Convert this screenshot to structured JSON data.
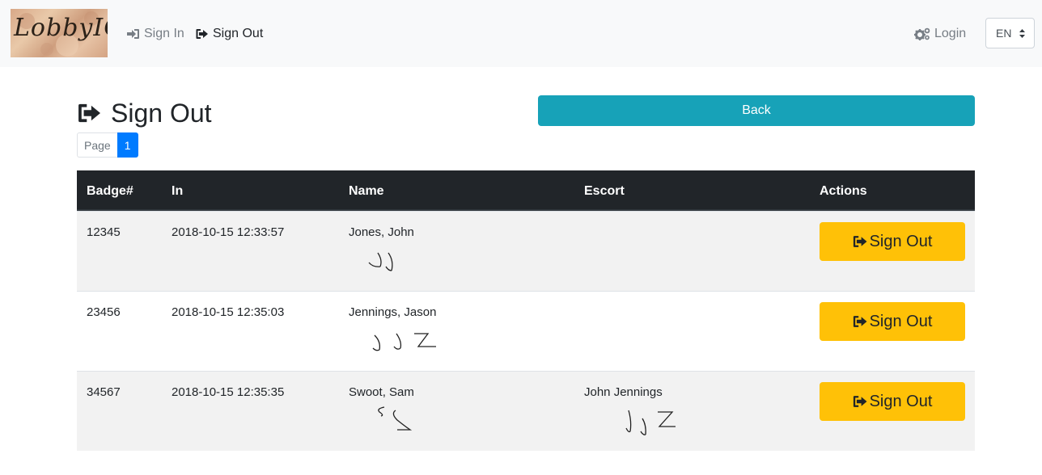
{
  "navbar": {
    "brand_text": "LobbyIO",
    "links": [
      {
        "label": "Sign In",
        "icon": "sign-in-icon"
      },
      {
        "label": "Sign Out",
        "icon": "sign-out-icon"
      }
    ],
    "login_label": "Login",
    "login_icon": "cogs-icon",
    "language": "EN"
  },
  "header": {
    "title": "Sign Out",
    "title_icon": "sign-out-icon",
    "back_label": "Back"
  },
  "pagination": {
    "label": "Page",
    "current": "1"
  },
  "table": {
    "columns": [
      "Badge#",
      "In",
      "Name",
      "Escort",
      "Actions"
    ],
    "rows": [
      {
        "badge": "12345",
        "in": "2018-10-15 12:33:57",
        "name": "Jones, John",
        "escort": "",
        "action": "Sign Out"
      },
      {
        "badge": "23456",
        "in": "2018-10-15 12:35:03",
        "name": "Jennings, Jason",
        "escort": "",
        "action": "Sign Out"
      },
      {
        "badge": "34567",
        "in": "2018-10-15 12:35:35",
        "name": "Swoot, Sam",
        "escort": "John Jennings",
        "action": "Sign Out"
      }
    ]
  },
  "colors": {
    "navbar_bg": "#f8f9fa",
    "back_button": "#17a2b8",
    "page_active": "#007bff",
    "action_button": "#ffc107",
    "table_header": "#212529",
    "row_stripe": "#f2f2f2"
  }
}
